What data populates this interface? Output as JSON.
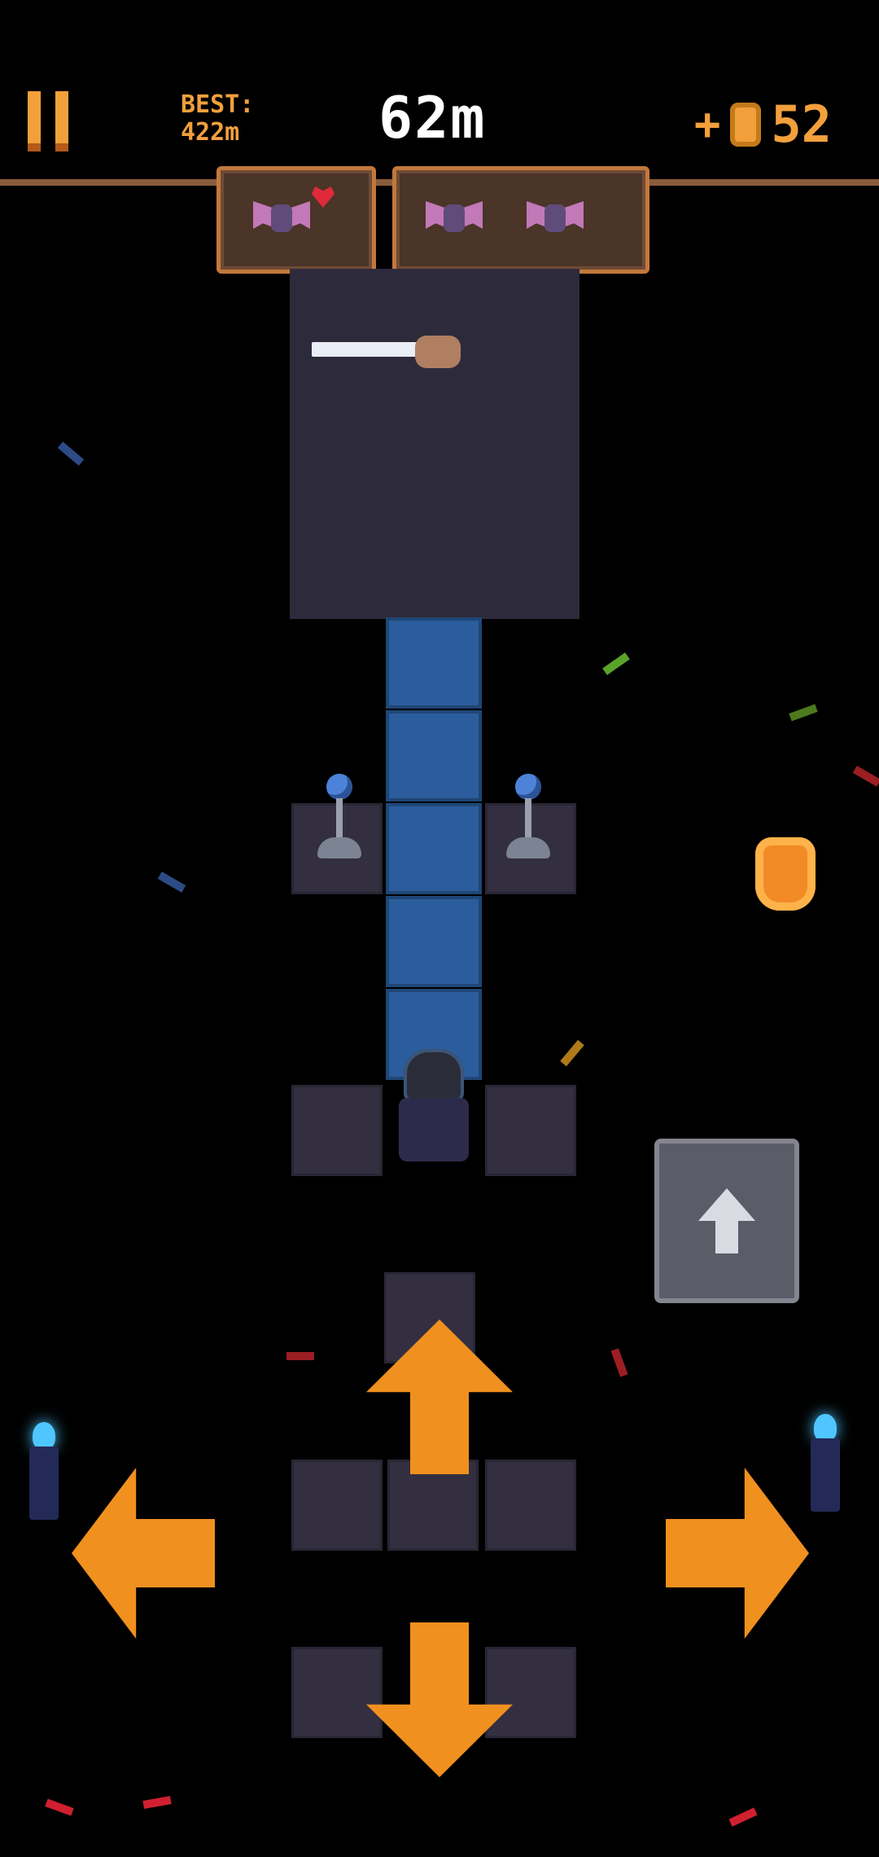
{
  "hud": {
    "best_label": "BEST:",
    "best_value": "422m",
    "distance": "62m",
    "coin_plus": "+",
    "coins": "52"
  },
  "colors": {
    "accent_orange": "#f0901f",
    "ice_blue": "#2b5d9c",
    "torch_blue": "#4fc6ff"
  },
  "enemy_panels": [
    {
      "bats": 1,
      "heart": true
    },
    {
      "bats": 2,
      "heart": false
    }
  ],
  "controls": {
    "jump_icon": "arrow-up-icon",
    "dpad": [
      "arrow-up-icon",
      "arrow-left-icon",
      "arrow-right-icon",
      "arrow-down-icon"
    ]
  }
}
